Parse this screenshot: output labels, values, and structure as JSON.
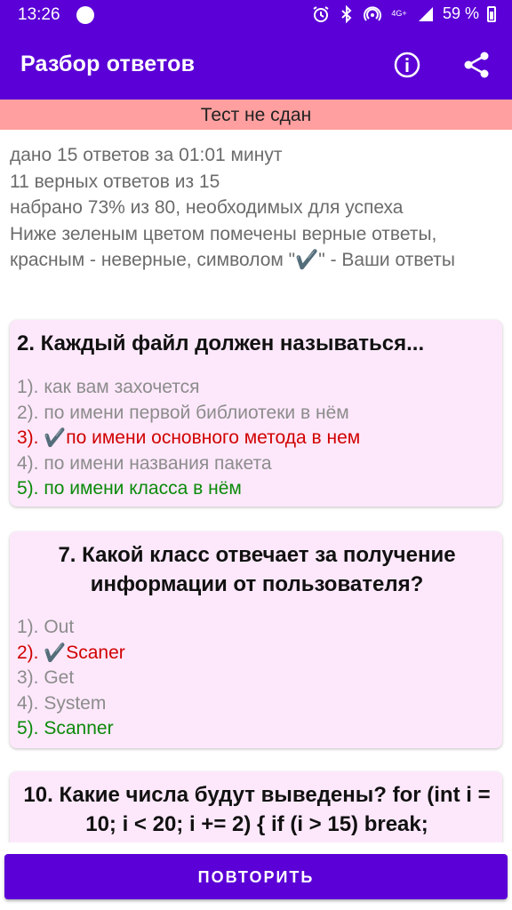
{
  "status_bar": {
    "time": "13:26",
    "network": "4G+",
    "battery": "59 %",
    "icons": [
      "alarm-icon",
      "bluetooth-icon",
      "hotspot-icon",
      "signal-icon",
      "battery-icon"
    ]
  },
  "app_bar": {
    "title": "Разбор ответов",
    "info_icon": "info-icon",
    "share_icon": "share-icon",
    "color": "#5b00d6"
  },
  "result_banner": {
    "text": "Тест не сдан",
    "color": "#ff9f9f"
  },
  "summary": {
    "line1": "дано 15 ответов за 01:01 минут",
    "line2": "11 верных ответов из 15",
    "line3": "набрано 73% из 80, необходимых для успеха",
    "line4": " Ниже зеленым цветом помечены верные ответы, красным - неверные, символом \"✔️\" - Ваши ответы"
  },
  "colors": {
    "correct": "#0a8a0a",
    "wrong": "#d00000",
    "neutral": "#8c8c8c",
    "card_bg": "#fde8fb"
  },
  "questions": [
    {
      "title": "2. Каждый файл должен называться...",
      "answers": [
        {
          "text": "1). как вам захочется",
          "state": "neutral"
        },
        {
          "text": "2). по имени первой библиотеки в нём",
          "state": "neutral"
        },
        {
          "prefix": "3). ",
          "check": "✔️",
          "text": "по имени основного метода в нем",
          "state": "wrong"
        },
        {
          "text": "4). по имени названия пакета",
          "state": "neutral"
        },
        {
          "text": "5). по имени класса в нём",
          "state": "correct"
        }
      ]
    },
    {
      "title": "7. Какой класс отвечает за получение информации от пользователя?",
      "answers": [
        {
          "text": "1). Out",
          "state": "neutral"
        },
        {
          "prefix": "2). ",
          "check": "✔️",
          "text": "Scaner",
          "state": "wrong"
        },
        {
          "text": "3). Get",
          "state": "neutral"
        },
        {
          "text": "4). System",
          "state": "neutral"
        },
        {
          "text": "5). Scanner",
          "state": "correct"
        }
      ]
    },
    {
      "title": "10. Какие числа будут выведены? for (int i = 10; i < 20; i += 2) { if (i > 15) break;"
    }
  ],
  "repeat_button": {
    "label": "ПОВТОРИТЬ"
  }
}
